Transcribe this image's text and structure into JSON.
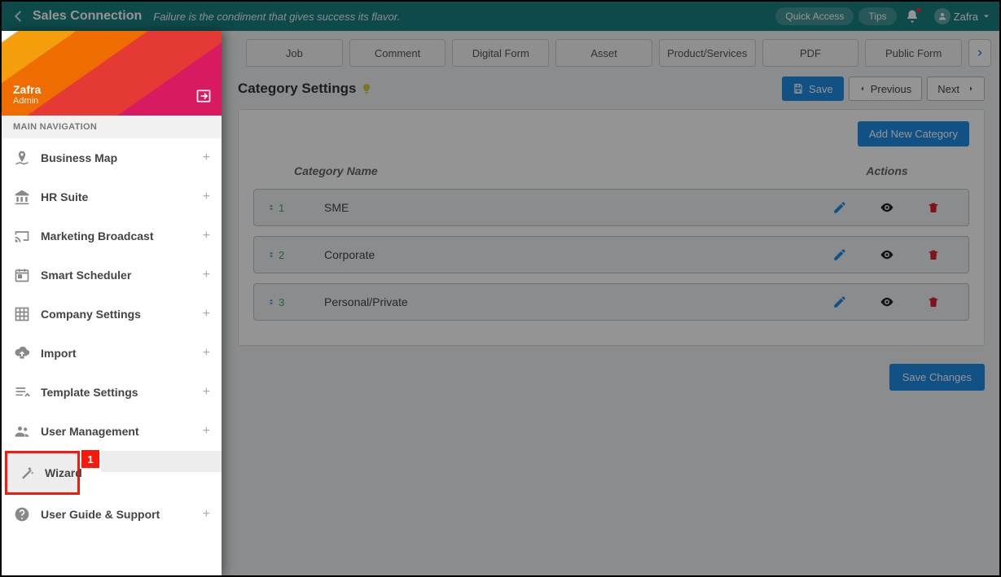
{
  "header": {
    "brand": "Sales Connection",
    "tagline": "Failure is the condiment that gives success its flavor.",
    "quick_access": "Quick Access",
    "tips": "Tips",
    "username": "Zafra"
  },
  "sidebar": {
    "user": {
      "name": "Zafra",
      "role": "Admin"
    },
    "section_title": "MAIN NAVIGATION",
    "items": [
      {
        "label": "Business Map",
        "icon": "map-pin-icon"
      },
      {
        "label": "HR Suite",
        "icon": "bank-icon"
      },
      {
        "label": "Marketing Broadcast",
        "icon": "cast-icon"
      },
      {
        "label": "Smart Scheduler",
        "icon": "calendar-icon"
      },
      {
        "label": "Company Settings",
        "icon": "grid-icon"
      },
      {
        "label": "Import",
        "icon": "cloud-upload-icon"
      },
      {
        "label": "Template Settings",
        "icon": "list-icon"
      },
      {
        "label": "User Management",
        "icon": "users-icon"
      },
      {
        "label": "Wizard",
        "icon": "wand-icon"
      },
      {
        "label": "User Guide & Support",
        "icon": "help-icon"
      }
    ],
    "highlight_badge": "1"
  },
  "tabs": {
    "items": [
      "Job",
      "Comment",
      "Digital Form",
      "Asset",
      "Product/Services",
      "PDF",
      "Public Form"
    ]
  },
  "page": {
    "title": "Category Settings",
    "save": "Save",
    "previous": "Previous",
    "next": "Next",
    "add_new": "Add New Category",
    "col_name": "Category Name",
    "col_actions": "Actions",
    "rows": [
      {
        "order": "1",
        "name": "SME"
      },
      {
        "order": "2",
        "name": "Corporate"
      },
      {
        "order": "3",
        "name": "Personal/Private"
      }
    ],
    "save_changes": "Save Changes"
  }
}
